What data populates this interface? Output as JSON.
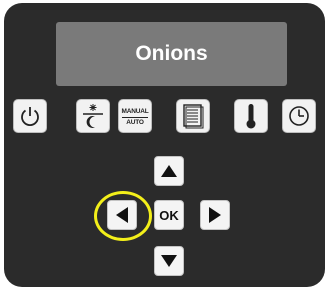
{
  "display": {
    "text": "Onions"
  },
  "function_keys": [
    {
      "name": "power",
      "icon": "power-icon"
    },
    {
      "name": "day-night",
      "icon": "sun-moon-icon"
    },
    {
      "name": "manual-auto",
      "icon": "manual-auto-icon",
      "top_label": "MANUAL",
      "bottom_label": "AUTO"
    },
    {
      "name": "list",
      "icon": "document-list-icon"
    },
    {
      "name": "temperature",
      "icon": "thermometer-icon"
    },
    {
      "name": "clock",
      "icon": "clock-icon"
    }
  ],
  "navigation": {
    "ok_label": "OK",
    "up_icon": "arrow-up-icon",
    "down_icon": "arrow-down-icon",
    "left_icon": "arrow-left-icon",
    "right_icon": "arrow-right-icon"
  },
  "highlight": {
    "target": "left-button",
    "color": "#f3ef1a"
  },
  "colors": {
    "panel": "#2b2b2b",
    "display": "#7a7a7a",
    "key": "#f2f2f2"
  }
}
